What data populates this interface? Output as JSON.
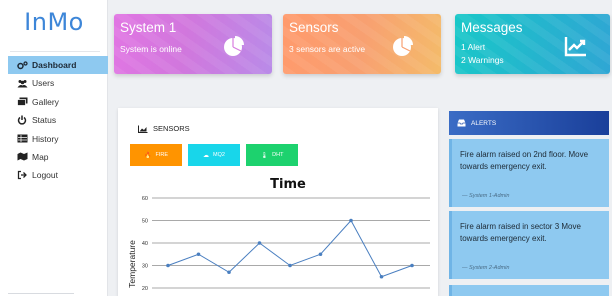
{
  "brand": "InMo",
  "nav": [
    {
      "label": "Dashboard",
      "icon": "gears-icon",
      "active": true
    },
    {
      "label": "Users",
      "icon": "users-icon",
      "active": false
    },
    {
      "label": "Gallery",
      "icon": "gallery-icon",
      "active": false
    },
    {
      "label": "Status",
      "icon": "power-icon",
      "active": false
    },
    {
      "label": "History",
      "icon": "table-icon",
      "active": false
    },
    {
      "label": "Map",
      "icon": "map-icon",
      "active": false
    },
    {
      "label": "Logout",
      "icon": "logout-icon",
      "active": false
    }
  ],
  "cards": [
    {
      "title": "System 1",
      "lines": [
        "System is online"
      ],
      "icon": "pie-chart-icon"
    },
    {
      "title": "Sensors",
      "lines": [
        "3 sensors are active"
      ],
      "icon": "pie-chart-icon"
    },
    {
      "title": "Messages",
      "lines": [
        "1 Alert",
        "2 Warnings"
      ],
      "icon": "line-chart-icon"
    }
  ],
  "sensors_panel": {
    "title": "SENSORS",
    "buttons": [
      {
        "label": "FIRE",
        "icon": "flame-icon",
        "color": "#ff9400"
      },
      {
        "label": "MQ2",
        "icon": "gas-icon",
        "color": "#18d6ea"
      },
      {
        "label": "DHT",
        "icon": "thermometer-icon",
        "color": "#1dd26e"
      }
    ]
  },
  "chart_data": {
    "type": "line",
    "title": "Time",
    "xlabel": "",
    "ylabel": "Temperature",
    "y_ticks": [
      20,
      30,
      40,
      50,
      60
    ],
    "ylim": [
      20,
      60
    ],
    "values": [
      30,
      35,
      27,
      40,
      30,
      35,
      50,
      25,
      30
    ],
    "line_color": "#4a7fc0",
    "grid": true
  },
  "alerts": {
    "title": "ALERTS",
    "items": [
      {
        "text": "Fire alarm raised on 2nd floor. Move towards emergency exit.",
        "source": "— System 1-Admin"
      },
      {
        "text": "Fire alarm raised in sector 3 Move towards emergency exit.",
        "source": "— System 2-Admin"
      }
    ]
  }
}
